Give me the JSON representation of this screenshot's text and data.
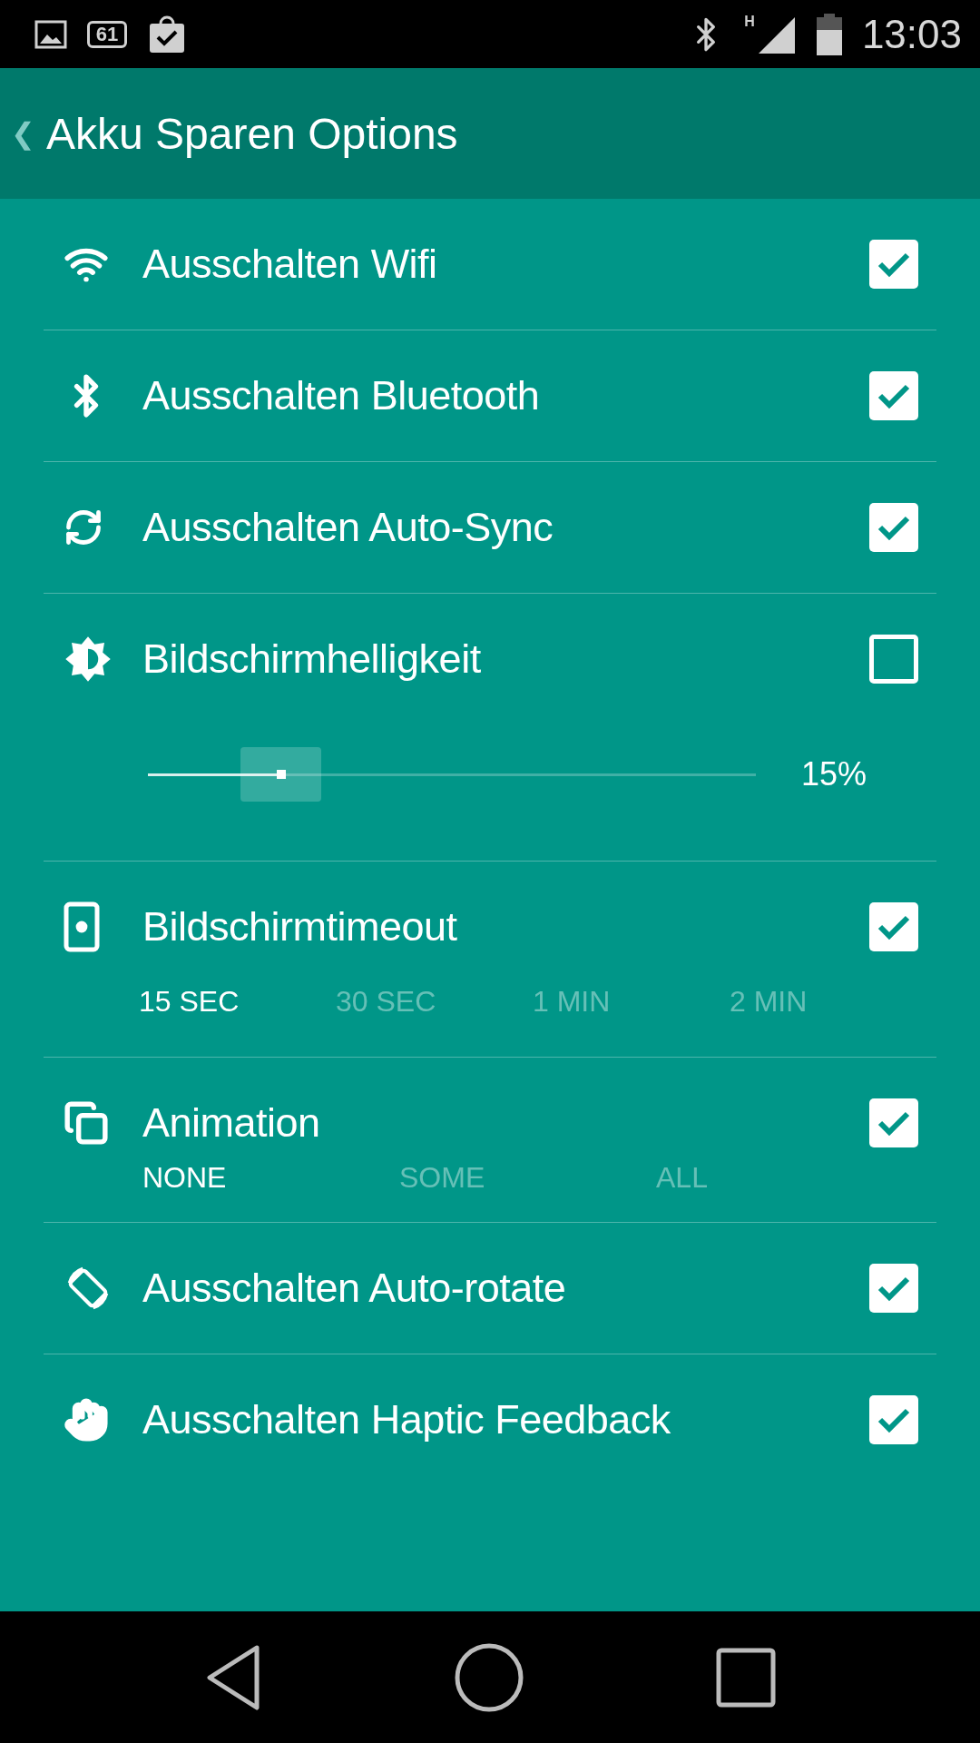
{
  "status_bar": {
    "battery_percent": "61",
    "network": "H",
    "time": "13:03"
  },
  "app_bar": {
    "back": "❮",
    "title": "Akku Sparen Options"
  },
  "settings": [
    {
      "kind": "check",
      "label": "Ausschalten Wifi",
      "checked": true
    },
    {
      "kind": "check",
      "label": "Ausschalten Bluetooth",
      "checked": true
    },
    {
      "kind": "check",
      "label": "Ausschalten Auto-Sync",
      "checked": true
    },
    {
      "kind": "slider",
      "label": "Bildschirmhelligkeit",
      "checked": false,
      "level": 0.22,
      "reading": "15%"
    },
    {
      "kind": "choice",
      "label": "Bildschirmtimeout",
      "checked": true,
      "options": [
        {
          "label": "15 SEC",
          "selected": true
        },
        {
          "label": "30 SEC",
          "selected": false
        },
        {
          "label": "1 MIN",
          "selected": false
        },
        {
          "label": "2 MIN",
          "selected": false
        }
      ]
    },
    {
      "kind": "choice",
      "label": "Animation",
      "checked": true,
      "options": [
        {
          "label": "NONE",
          "selected": true
        },
        {
          "label": "SOME",
          "selected": false
        },
        {
          "label": "ALL",
          "selected": false
        }
      ]
    },
    {
      "kind": "check",
      "label": "Ausschalten Auto-rotate",
      "checked": true
    },
    {
      "kind": "check",
      "label": "Ausschalten Haptic Feedback",
      "checked": true
    }
  ]
}
